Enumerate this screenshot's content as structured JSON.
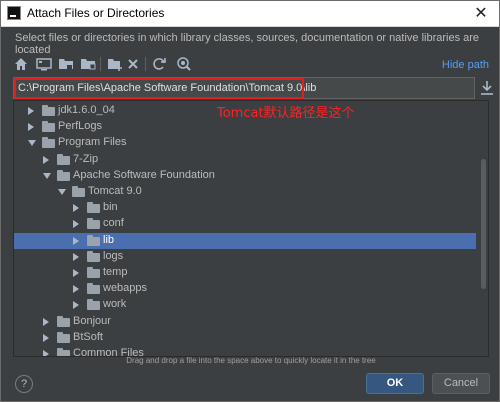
{
  "window": {
    "title": "Attach Files or Directories",
    "close_glyph": "✕"
  },
  "subtitle": "Select files or directories in which library classes, sources, documentation or native libraries are located",
  "toolbar": {
    "buttons": [
      "home-icon",
      "desktop-icon",
      "project-icon",
      "module-icon",
      "new-folder-icon",
      "delete-icon",
      "refresh-icon",
      "show-hidden-icon"
    ],
    "hide_path_label": "Hide path"
  },
  "path": {
    "value": "C:\\Program Files\\Apache Software Foundation\\Tomcat 9.0\\lib",
    "highlight_color": "#e02020"
  },
  "annotation": "Tomcat默认路径是这个",
  "tree": {
    "rows": [
      {
        "label": "jdk1.6.0_04",
        "expanded": false,
        "depth": 1,
        "selected": false
      },
      {
        "label": "PerfLogs",
        "expanded": false,
        "depth": 1,
        "selected": false
      },
      {
        "label": "Program Files",
        "expanded": true,
        "depth": 1,
        "selected": false
      },
      {
        "label": "7-Zip",
        "expanded": false,
        "depth": 2,
        "selected": false
      },
      {
        "label": "Apache Software Foundation",
        "expanded": true,
        "depth": 2,
        "selected": false
      },
      {
        "label": "Tomcat 9.0",
        "expanded": true,
        "depth": 3,
        "selected": false
      },
      {
        "label": "bin",
        "expanded": false,
        "depth": 4,
        "selected": false
      },
      {
        "label": "conf",
        "expanded": false,
        "depth": 4,
        "selected": false
      },
      {
        "label": "lib",
        "expanded": false,
        "depth": 4,
        "selected": true
      },
      {
        "label": "logs",
        "expanded": false,
        "depth": 4,
        "selected": false
      },
      {
        "label": "temp",
        "expanded": false,
        "depth": 4,
        "selected": false
      },
      {
        "label": "webapps",
        "expanded": false,
        "depth": 4,
        "selected": false
      },
      {
        "label": "work",
        "expanded": false,
        "depth": 4,
        "selected": false
      },
      {
        "label": "Bonjour",
        "expanded": false,
        "depth": 2,
        "selected": false
      },
      {
        "label": "BtSoft",
        "expanded": false,
        "depth": 2,
        "selected": false
      },
      {
        "label": "Common Files",
        "expanded": false,
        "depth": 2,
        "selected": false
      }
    ],
    "selection_color": "#4b6eaf"
  },
  "drag_hint": "Drag and drop a file into the space above to quickly locate it in the tree",
  "buttons": {
    "help": "?",
    "ok": "OK",
    "cancel": "Cancel"
  }
}
